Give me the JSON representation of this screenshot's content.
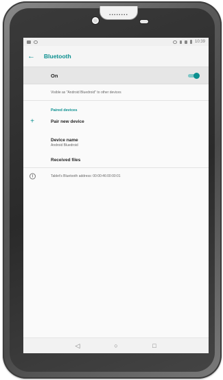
{
  "device": {
    "speaker_text": "........"
  },
  "status_bar": {
    "time": "10:39"
  },
  "toolbar": {
    "title": "Bluetooth",
    "back_icon": "arrow-left-icon"
  },
  "master_switch": {
    "label": "On",
    "state": "on"
  },
  "visibility_text": "Visible as \"Android Bluedroid\" to other devices",
  "paired_section": {
    "title": "Paired devices"
  },
  "pair_new": {
    "icon": "plus-icon",
    "label": "Pair new device"
  },
  "device_name": {
    "title": "Device name",
    "value": "Android Bluedroid"
  },
  "received_files": {
    "label": "Received files"
  },
  "address_info": {
    "icon": "info-icon",
    "text": "Tablet's Bluetooth address: 00:00:46:00:00:01"
  },
  "nav_bar": {
    "back": "◁",
    "home": "○",
    "recents": "□"
  },
  "colors": {
    "accent": "#0a8f8f",
    "toggle_track": "#7fc7c7"
  }
}
